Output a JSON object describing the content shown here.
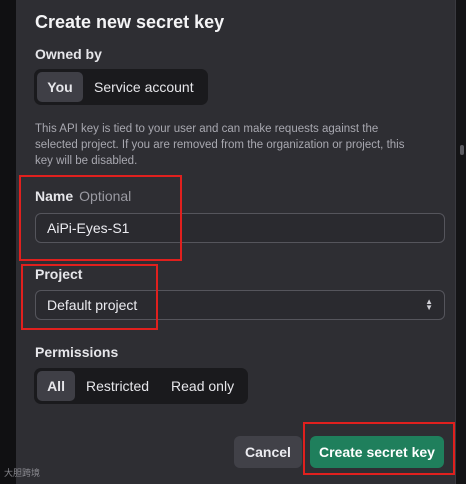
{
  "dialog": {
    "title": "Create new secret key",
    "owned_by": {
      "label": "Owned by",
      "options": [
        "You",
        "Service account"
      ],
      "selected": "You"
    },
    "description": "This API key is tied to your user and can make requests against the selected project. If you are removed from the organization or project, this key will be disabled.",
    "name": {
      "label": "Name",
      "hint": "Optional",
      "value": "AiPi-Eyes-S1"
    },
    "project": {
      "label": "Project",
      "value": "Default project"
    },
    "permissions": {
      "label": "Permissions",
      "options": [
        "All",
        "Restricted",
        "Read only"
      ],
      "selected": "All"
    },
    "cancel_label": "Cancel",
    "create_label": "Create secret key"
  },
  "annotation_color": "#e0201e",
  "accent_color": "#1f7f5c",
  "watermark": "大胆跨境"
}
